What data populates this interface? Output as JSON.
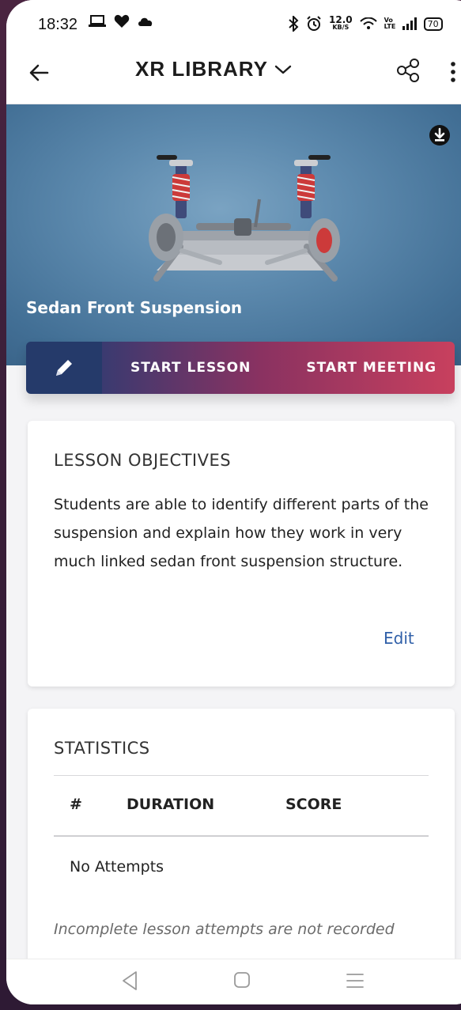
{
  "status_bar": {
    "time": "18:32",
    "network_speed_value": "12.0",
    "network_speed_unit": "KB/S",
    "volte_label": "Vo LTE",
    "battery": "70",
    "left_icons": [
      "laptop-icon",
      "heart-icon",
      "cloud-icon"
    ],
    "right_icons": [
      "bluetooth-icon",
      "alarm-icon",
      "wifi-icon",
      "signal-icon",
      "battery-icon"
    ]
  },
  "header": {
    "title": "XR LIBRARY",
    "icons": [
      "back-arrow-icon",
      "chevron-down-icon",
      "share-icon",
      "more-vert-icon"
    ]
  },
  "hero": {
    "title": "Sedan Front Suspension",
    "icons": [
      "download-icon"
    ],
    "image": "sedan-front-suspension-model"
  },
  "actions": {
    "edit_icon": "pencil-icon",
    "start_lesson": "START LESSON",
    "start_meeting": "START MEETING"
  },
  "objectives": {
    "heading": "LESSON OBJECTIVES",
    "text": "Students are able to identify different parts of the suspension and explain how they work in very much linked sedan front suspension structure.",
    "edit_label": "Edit"
  },
  "statistics": {
    "heading": "STATISTICS",
    "columns": [
      "#",
      "DURATION",
      "SCORE"
    ],
    "empty_text": "No Attempts",
    "note": "Incomplete lesson attempts are not recorded"
  },
  "nav_bar": {
    "icons": [
      "nav-back-icon",
      "nav-home-icon",
      "nav-recents-icon"
    ]
  },
  "colors": {
    "edit_button": "#253a6a",
    "action_gradient_start": "#3a3a70",
    "action_gradient_end": "#c8405e",
    "link": "#2f5fa8",
    "hero_bg": "#5d8aae"
  }
}
